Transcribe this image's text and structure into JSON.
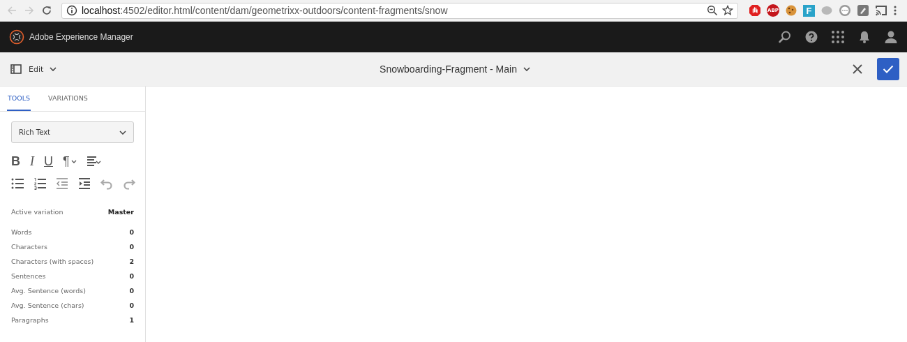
{
  "browser": {
    "back": {
      "disabled": true
    },
    "forward": {
      "disabled": true
    },
    "url": "**localhost**:4502/editor.html/content/dam/geometrixx-outdoors/content-fragments/snow",
    "extensions": [
      {
        "kind": "hand",
        "color": "#e02020"
      },
      {
        "kind": "abp",
        "label": "ABP",
        "color": "#c4161c"
      },
      {
        "kind": "cookie",
        "color": "#d9933a"
      },
      {
        "kind": "letter",
        "label": "F",
        "color": "#2aa3c9"
      },
      {
        "kind": "round",
        "color": "#b8b8b8"
      },
      {
        "kind": "ring",
        "color": "#9a9a9a"
      },
      {
        "kind": "square",
        "color": "#777777"
      },
      {
        "kind": "cast",
        "color": "#555555"
      }
    ]
  },
  "header": {
    "product": "Adobe Experience Manager"
  },
  "action_bar": {
    "mode": "Edit",
    "title": "Snowboarding-Fragment - Main"
  },
  "sidebar": {
    "tabs": [
      {
        "label": "TOOLS",
        "selected": true
      },
      {
        "label": "VARIATIONS",
        "selected": false
      }
    ],
    "format_select": {
      "value": "Rich Text"
    },
    "toolbar": [
      [
        {
          "kind": "bold",
          "label": "B"
        },
        {
          "kind": "italic",
          "label": "I"
        },
        {
          "kind": "underline",
          "label": "U"
        },
        {
          "kind": "paragraph",
          "label": "¶"
        },
        {
          "kind": "align"
        }
      ],
      [
        {
          "kind": "bullets"
        },
        {
          "kind": "numbers"
        },
        {
          "kind": "outdent"
        },
        {
          "kind": "indent"
        },
        {
          "kind": "undo",
          "disabled": true
        },
        {
          "kind": "redo",
          "disabled": true
        }
      ]
    ],
    "active_variation": {
      "label": "Active variation",
      "value": "Master"
    },
    "stats": [
      {
        "label": "Words",
        "value": "0"
      },
      {
        "label": "Characters",
        "value": "0"
      },
      {
        "label": "Characters (with spaces)",
        "value": "2"
      },
      {
        "label": "Sentences",
        "value": "0"
      },
      {
        "label": "Avg. Sentence (words)",
        "value": "0"
      },
      {
        "label": "Avg. Sentence (chars)",
        "value": "0"
      },
      {
        "label": "Paragraphs",
        "value": "1"
      }
    ]
  }
}
